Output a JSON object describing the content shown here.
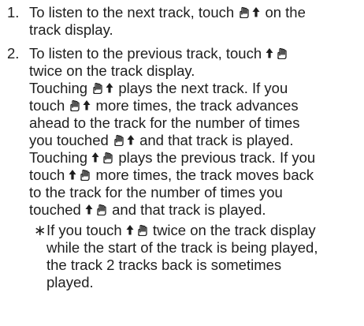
{
  "steps": [
    {
      "num": "1.",
      "lines": [
        [
          "To listen to the next track, touch ",
          {
            "icon": "next-track-icon"
          },
          " on the"
        ],
        [
          "track display."
        ]
      ]
    },
    {
      "num": "2.",
      "lines": [
        [
          "To listen to the previous track, touch ",
          {
            "icon": "previous-track-icon"
          }
        ],
        [
          "twice on the track display."
        ],
        [
          "Touching ",
          {
            "icon": "next-track-icon"
          },
          " plays the next track. If you"
        ],
        [
          "touch ",
          {
            "icon": "next-track-icon"
          },
          " more times, the track advances"
        ],
        [
          "ahead to the track for the number of times"
        ],
        [
          "you touched ",
          {
            "icon": "next-track-icon"
          },
          " and that track is played."
        ],
        [
          "Touching ",
          {
            "icon": "previous-track-icon"
          },
          " plays the previous track. If you"
        ],
        [
          "touch ",
          {
            "icon": "previous-track-icon"
          },
          " more times, the track moves back"
        ],
        [
          "to the track for the number of times you"
        ],
        [
          "touched ",
          {
            "icon": "previous-track-icon"
          },
          " and that track is played."
        ]
      ],
      "note": {
        "mark": "∗",
        "lines": [
          [
            "If you touch ",
            {
              "icon": "previous-track-icon"
            },
            " twice on the track display"
          ],
          [
            "while the start of the track is being played,"
          ],
          [
            "the track 2 tracks back is sometimes"
          ],
          [
            "played."
          ]
        ]
      }
    }
  ]
}
